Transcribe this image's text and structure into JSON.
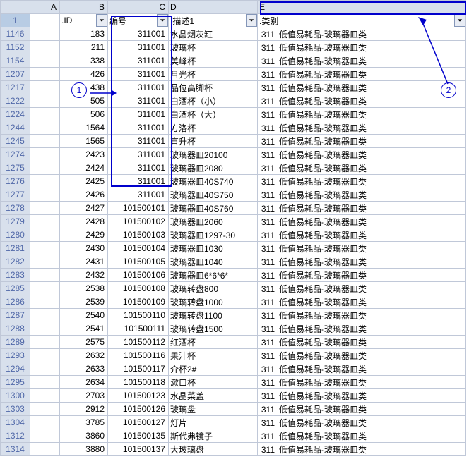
{
  "columns": [
    "A",
    "B",
    "C",
    "D",
    "E"
  ],
  "selectedRowIndex": 0,
  "headerRow": {
    "A": "",
    "B": ".ID",
    "C": "编号",
    "D": ".描述1",
    "E": ".类别"
  },
  "rows": [
    {
      "r": "1146",
      "B": "183",
      "C": "311001",
      "D": "水晶烟灰缸",
      "Enum": "311",
      "Etxt": "低值易耗品-玻璃器皿类"
    },
    {
      "r": "1152",
      "B": "211",
      "C": "311001",
      "D": "玻璃杯",
      "Enum": "311",
      "Etxt": "低值易耗品-玻璃器皿类"
    },
    {
      "r": "1154",
      "B": "338",
      "C": "311001",
      "D": "美峰杯",
      "Enum": "311",
      "Etxt": "低值易耗品-玻璃器皿类"
    },
    {
      "r": "1207",
      "B": "426",
      "C": "311001",
      "D": "月光杯",
      "Enum": "311",
      "Etxt": "低值易耗品-玻璃器皿类"
    },
    {
      "r": "1217",
      "B": "438",
      "C": "311001",
      "D": "品位高脚杯",
      "Enum": "311",
      "Etxt": "低值易耗品-玻璃器皿类"
    },
    {
      "r": "1222",
      "B": "505",
      "C": "311001",
      "D": "白酒杯（小）",
      "Enum": "311",
      "Etxt": "低值易耗品-玻璃器皿类"
    },
    {
      "r": "1224",
      "B": "506",
      "C": "311001",
      "D": "白酒杯（大）",
      "Enum": "311",
      "Etxt": "低值易耗品-玻璃器皿类"
    },
    {
      "r": "1244",
      "B": "1564",
      "C": "311001",
      "D": "方洛杯",
      "Enum": "311",
      "Etxt": "低值易耗品-玻璃器皿类"
    },
    {
      "r": "1245",
      "B": "1565",
      "C": "311001",
      "D": "直升杯",
      "Enum": "311",
      "Etxt": "低值易耗品-玻璃器皿类"
    },
    {
      "r": "1274",
      "B": "2423",
      "C": "311001",
      "D": "玻璃器皿20100",
      "Enum": "311",
      "Etxt": "低值易耗品-玻璃器皿类"
    },
    {
      "r": "1275",
      "B": "2424",
      "C": "311001",
      "D": "玻璃器皿2080",
      "Enum": "311",
      "Etxt": "低值易耗品-玻璃器皿类"
    },
    {
      "r": "1276",
      "B": "2425",
      "C": "311001",
      "D": "玻璃器皿40S740",
      "Enum": "311",
      "Etxt": "低值易耗品-玻璃器皿类"
    },
    {
      "r": "1277",
      "B": "2426",
      "C": "311001",
      "D": "玻璃器皿40S750",
      "Enum": "311",
      "Etxt": "低值易耗品-玻璃器皿类"
    },
    {
      "r": "1278",
      "B": "2427",
      "C": "101500101",
      "D": "玻璃器皿40S760",
      "Enum": "311",
      "Etxt": "低值易耗品-玻璃器皿类"
    },
    {
      "r": "1279",
      "B": "2428",
      "C": "101500102",
      "D": "玻璃器皿2060",
      "Enum": "311",
      "Etxt": "低值易耗品-玻璃器皿类"
    },
    {
      "r": "1280",
      "B": "2429",
      "C": "101500103",
      "D": "玻璃器皿1297-30",
      "Enum": "311",
      "Etxt": "低值易耗品-玻璃器皿类"
    },
    {
      "r": "1281",
      "B": "2430",
      "C": "101500104",
      "D": "玻璃器皿1030",
      "Enum": "311",
      "Etxt": "低值易耗品-玻璃器皿类"
    },
    {
      "r": "1282",
      "B": "2431",
      "C": "101500105",
      "D": "玻璃器皿1040",
      "Enum": "311",
      "Etxt": "低值易耗品-玻璃器皿类"
    },
    {
      "r": "1283",
      "B": "2432",
      "C": "101500106",
      "D": "玻璃器皿6*6*6*",
      "Enum": "311",
      "Etxt": "低值易耗品-玻璃器皿类"
    },
    {
      "r": "1285",
      "B": "2538",
      "C": "101500108",
      "D": "玻璃转盘800",
      "Enum": "311",
      "Etxt": "低值易耗品-玻璃器皿类"
    },
    {
      "r": "1286",
      "B": "2539",
      "C": "101500109",
      "D": "玻璃转盘1000",
      "Enum": "311",
      "Etxt": "低值易耗品-玻璃器皿类"
    },
    {
      "r": "1287",
      "B": "2540",
      "C": "101500110",
      "D": "玻璃转盘1100",
      "Enum": "311",
      "Etxt": "低值易耗品-玻璃器皿类"
    },
    {
      "r": "1288",
      "B": "2541",
      "C": "101500111",
      "D": "玻璃转盘1500",
      "Enum": "311",
      "Etxt": "低值易耗品-玻璃器皿类"
    },
    {
      "r": "1289",
      "B": "2575",
      "C": "101500112",
      "D": "红酒杯",
      "Enum": "311",
      "Etxt": "低值易耗品-玻璃器皿类"
    },
    {
      "r": "1293",
      "B": "2632",
      "C": "101500116",
      "D": "果汁杯",
      "Enum": "311",
      "Etxt": "低值易耗品-玻璃器皿类"
    },
    {
      "r": "1294",
      "B": "2633",
      "C": "101500117",
      "D": "介杯2#",
      "Enum": "311",
      "Etxt": "低值易耗品-玻璃器皿类"
    },
    {
      "r": "1295",
      "B": "2634",
      "C": "101500118",
      "D": "漱口杯",
      "Enum": "311",
      "Etxt": "低值易耗品-玻璃器皿类"
    },
    {
      "r": "1300",
      "B": "2703",
      "C": "101500123",
      "D": "水晶菜盖",
      "Enum": "311",
      "Etxt": "低值易耗品-玻璃器皿类"
    },
    {
      "r": "1303",
      "B": "2912",
      "C": "101500126",
      "D": "玻璃盘",
      "Enum": "311",
      "Etxt": "低值易耗品-玻璃器皿类"
    },
    {
      "r": "1304",
      "B": "3785",
      "C": "101500127",
      "D": "灯片",
      "Enum": "311",
      "Etxt": "低值易耗品-玻璃器皿类"
    },
    {
      "r": "1312",
      "B": "3860",
      "C": "101500135",
      "D": "斯代弗镜子",
      "Enum": "311",
      "Etxt": "低值易耗品-玻璃器皿类"
    },
    {
      "r": "1314",
      "B": "3880",
      "C": "101500137",
      "D": "大玻璃盘",
      "Enum": "311",
      "Etxt": "低值易耗品-玻璃器皿类"
    }
  ],
  "annotations": {
    "circle1": "1",
    "circle2": "2"
  }
}
